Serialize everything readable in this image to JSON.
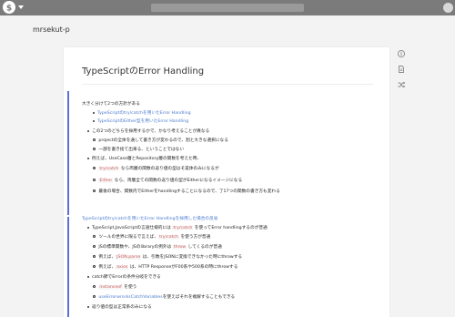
{
  "header": {
    "logo_icon": "esa-logo-icon"
  },
  "team": {
    "name": "mrsekut-p"
  },
  "post": {
    "title": "TypeScriptのError Handling",
    "lines": [
      {
        "text": "大きく分けて2つの方針がある"
      },
      {
        "text": "TypeScriptのtry/catchを用いたError Handling",
        "link": true
      },
      {
        "text": "TypeScriptのEither型を用いたError Handling",
        "link": true
      },
      {
        "text": "この2つのどちらを採用するかで、かなり考えることが異なる"
      },
      {
        "text": "projectの全体を通して書き方が変わるので、割と大きな選択になる"
      },
      {
        "text": "一部を書き捨て出来る、ということではない"
      },
      {
        "text": "例えば、UseCase層とRepository層の関数を考えた時、"
      },
      {
        "pre": "",
        "code": "try/catch",
        "post": " なら両層の関数の返り値の型はそ実体のみになるが"
      },
      {
        "pre": "",
        "code": "Either",
        "post": " なら、両層全ての関数の返り値の型がEitherになるイメージになる"
      },
      {
        "text": "最後の場合、関数内でEitherをhandlingすることになるので、了17つの関数の書き方も変わる"
      },
      {
        "text": "TypeScriptのtry/catchを用いたError Handlingを採用した場合の反省",
        "link": true
      },
      {
        "pre": "TypeScript,JavaScriptの言語仕様的には ",
        "code": "try/catch",
        "post": " を使ってError handlingするのが普通"
      },
      {
        "pre": "ツールの世界に限るで言えば、",
        "code": "try/catch",
        "post": " を使う方が普通"
      },
      {
        "pre": "JSの標準関数や、JSのlibraryの例外は ",
        "code": "throw",
        "post": " してくるのが普通"
      },
      {
        "pre": "例えば、",
        "code": "JSON.parse",
        "post": " は、引数をJSONに変換できなかった時にthrowする"
      },
      {
        "pre": "例えば、",
        "code": "axios",
        "post": " は、HTTP ResponseがF00系や500系の時にthrowする"
      },
      {
        "text": "catch節でErrorの条件分岐をできる"
      },
      {
        "pre": "",
        "code": "instanceof",
        "post": " を使う"
      },
      {
        "text": "useErrorwrorksCatchVariables",
        "link": true,
        "suffix": "を使えばそれを複解することもできる"
      },
      {
        "text": "返り値の型は正常系のみになる"
      }
    ]
  },
  "sidebar": {
    "icons": [
      "info-icon",
      "document-icon",
      "shuffle-icon"
    ]
  }
}
